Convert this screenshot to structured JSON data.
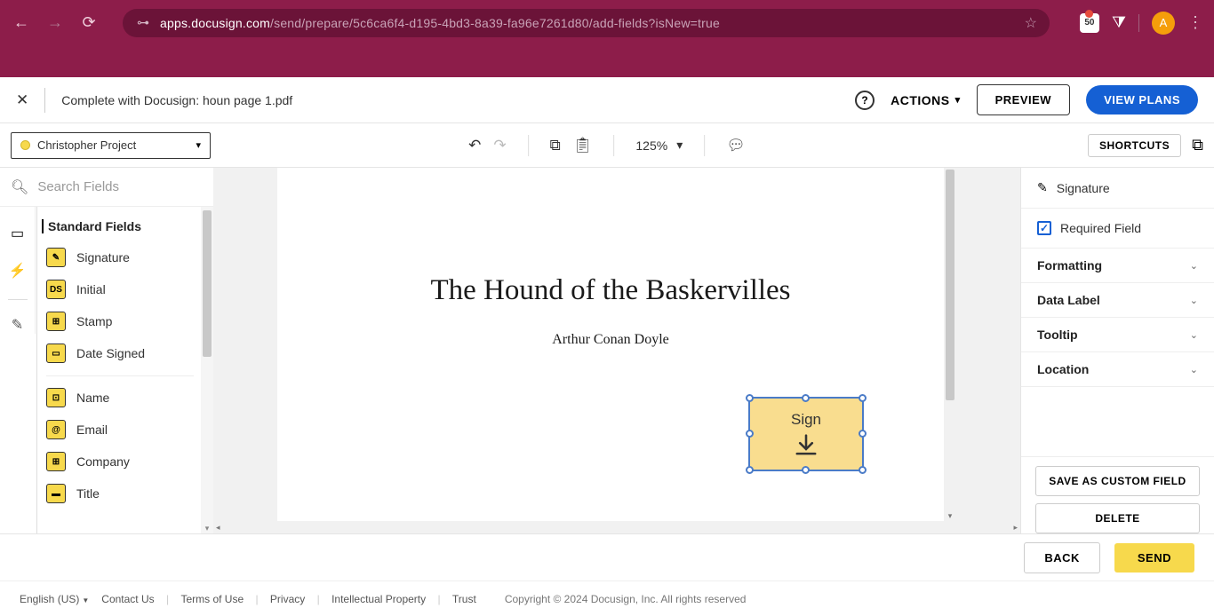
{
  "browser": {
    "url_host": "apps.docusign.com",
    "url_path": "/send/prepare/5c6ca6f4-d195-4bd3-8a39-fa96e7261d80/add-fields?isNew=true",
    "ext_badge": "50",
    "avatar_letter": "A"
  },
  "header": {
    "doc_title": "Complete with Docusign: houn page 1.pdf",
    "actions": "ACTIONS",
    "preview": "PREVIEW",
    "view_plans": "VIEW PLANS"
  },
  "toolbar": {
    "recipient": "Christopher Project",
    "zoom": "125%",
    "shortcuts": "SHORTCUTS"
  },
  "search": {
    "placeholder": "Search Fields"
  },
  "fields": {
    "category": "Standard Fields",
    "group1": [
      {
        "label": "Signature",
        "icon": "✎"
      },
      {
        "label": "Initial",
        "icon": "DS"
      },
      {
        "label": "Stamp",
        "icon": "⊞"
      },
      {
        "label": "Date Signed",
        "icon": "▭"
      }
    ],
    "group2": [
      {
        "label": "Name",
        "icon": "⊡"
      },
      {
        "label": "Email",
        "icon": "@"
      },
      {
        "label": "Company",
        "icon": "⊞"
      },
      {
        "label": "Title",
        "icon": "▬"
      }
    ]
  },
  "doc": {
    "title": "The Hound of the Baskervilles",
    "author": "Arthur Conan Doyle",
    "sign_label": "Sign"
  },
  "props": {
    "header": "Signature",
    "required": "Required Field",
    "sections": [
      "Formatting",
      "Data Label",
      "Tooltip",
      "Location"
    ],
    "save_custom": "SAVE AS CUSTOM FIELD",
    "delete": "DELETE"
  },
  "bottom": {
    "back": "BACK",
    "send": "SEND"
  },
  "footer": {
    "lang": "English (US)",
    "links": [
      "Contact Us",
      "Terms of Use",
      "Privacy",
      "Intellectual Property",
      "Trust"
    ],
    "copyright": "Copyright © 2024 Docusign, Inc. All rights reserved"
  }
}
